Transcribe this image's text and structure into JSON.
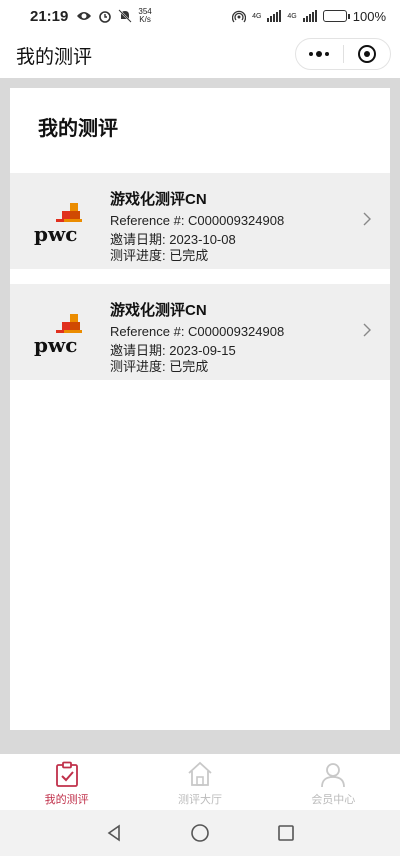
{
  "status_bar": {
    "time": "21:19",
    "net_speed_value": "354",
    "net_speed_unit": "K/s",
    "net_1": "4G",
    "net_2": "4G",
    "battery": "100%",
    "battery_level": 1.0
  },
  "header": {
    "title": "我的测评"
  },
  "main": {
    "heading": "我的测评",
    "items": [
      {
        "name": "游戏化测评CN",
        "reference": "Reference #:  C000009324908",
        "invite_date": "邀请日期:  2023-10-08",
        "progress": "测评进度:  已完成",
        "logo_text": "pwc"
      },
      {
        "name": "游戏化测评CN",
        "reference": "Reference #:  C000009324908",
        "invite_date": "邀请日期:  2023-09-15",
        "progress": "测评进度:  已完成",
        "logo_text": "pwc"
      }
    ]
  },
  "tab_bar": {
    "tabs": [
      {
        "label": "我的测评",
        "icon": "clipboard-check-icon",
        "active": true
      },
      {
        "label": "测评大厅",
        "icon": "home-icon",
        "active": false
      },
      {
        "label": "会员中心",
        "icon": "person-icon",
        "active": false
      }
    ]
  },
  "colors": {
    "accent": "#c0304a",
    "page_bg": "#d9d9d9",
    "item_bg": "#efefef",
    "inactive_tab": "#bbbbbb",
    "pwc_orange": "#e0301e",
    "pwc_amber": "#eb8c00"
  }
}
